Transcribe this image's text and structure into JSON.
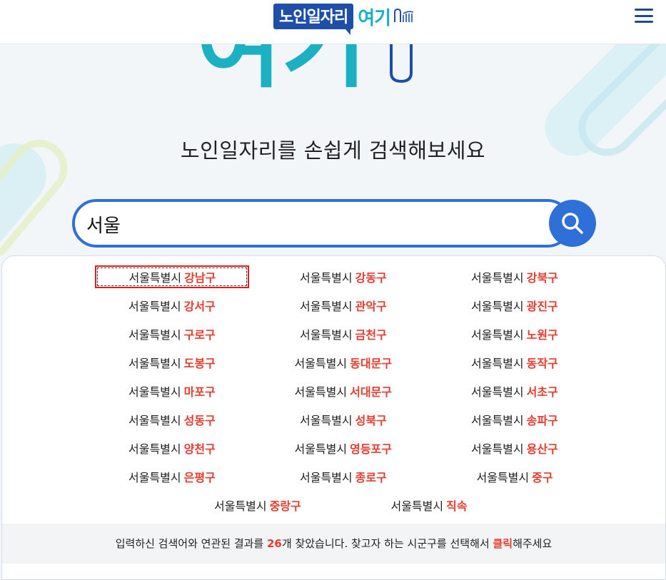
{
  "header": {
    "logo_main": "노인일자리",
    "logo_accent": "여기",
    "menu_icon": "hamburger-menu-icon"
  },
  "hero": {
    "big_text": "여기",
    "subtitle": "노인일자리를 손쉽게 검색해보세요"
  },
  "search": {
    "value": "서울",
    "button_icon": "search-icon"
  },
  "colors": {
    "accent_blue": "#2f6fd8",
    "highlight_red": "#e63b2e",
    "logo_teal": "#19aec7",
    "logo_navy": "#1e4fa8"
  },
  "results": [
    {
      "city": "서울특별시",
      "district": "강남구",
      "selected": true
    },
    {
      "city": "서울특별시",
      "district": "강동구"
    },
    {
      "city": "서울특별시",
      "district": "강북구"
    },
    {
      "city": "서울특별시",
      "district": "강서구"
    },
    {
      "city": "서울특별시",
      "district": "관악구"
    },
    {
      "city": "서울특별시",
      "district": "광진구"
    },
    {
      "city": "서울특별시",
      "district": "구로구"
    },
    {
      "city": "서울특별시",
      "district": "금천구"
    },
    {
      "city": "서울특별시",
      "district": "노원구"
    },
    {
      "city": "서울특별시",
      "district": "도봉구"
    },
    {
      "city": "서울특별시",
      "district": "동대문구"
    },
    {
      "city": "서울특별시",
      "district": "동작구"
    },
    {
      "city": "서울특별시",
      "district": "마포구"
    },
    {
      "city": "서울특별시",
      "district": "서대문구"
    },
    {
      "city": "서울특별시",
      "district": "서초구"
    },
    {
      "city": "서울특별시",
      "district": "성동구"
    },
    {
      "city": "서울특별시",
      "district": "성북구"
    },
    {
      "city": "서울특별시",
      "district": "송파구"
    },
    {
      "city": "서울특별시",
      "district": "양천구"
    },
    {
      "city": "서울특별시",
      "district": "영등포구"
    },
    {
      "city": "서울특별시",
      "district": "용산구"
    },
    {
      "city": "서울특별시",
      "district": "은평구"
    },
    {
      "city": "서울특별시",
      "district": "종로구"
    },
    {
      "city": "서울특별시",
      "district": "중구"
    },
    {
      "city": "서울특별시",
      "district": "중랑구"
    },
    {
      "city": "서울특별시",
      "district": "직속"
    }
  ],
  "footer": {
    "before_count": "입력하신 검색어와 연관된 결과를 ",
    "count": "26",
    "after_count": "개 찾았습니다. 찾고자 하는 시군구를 선택해서 ",
    "click_word": "클릭",
    "end": "해주세요"
  }
}
